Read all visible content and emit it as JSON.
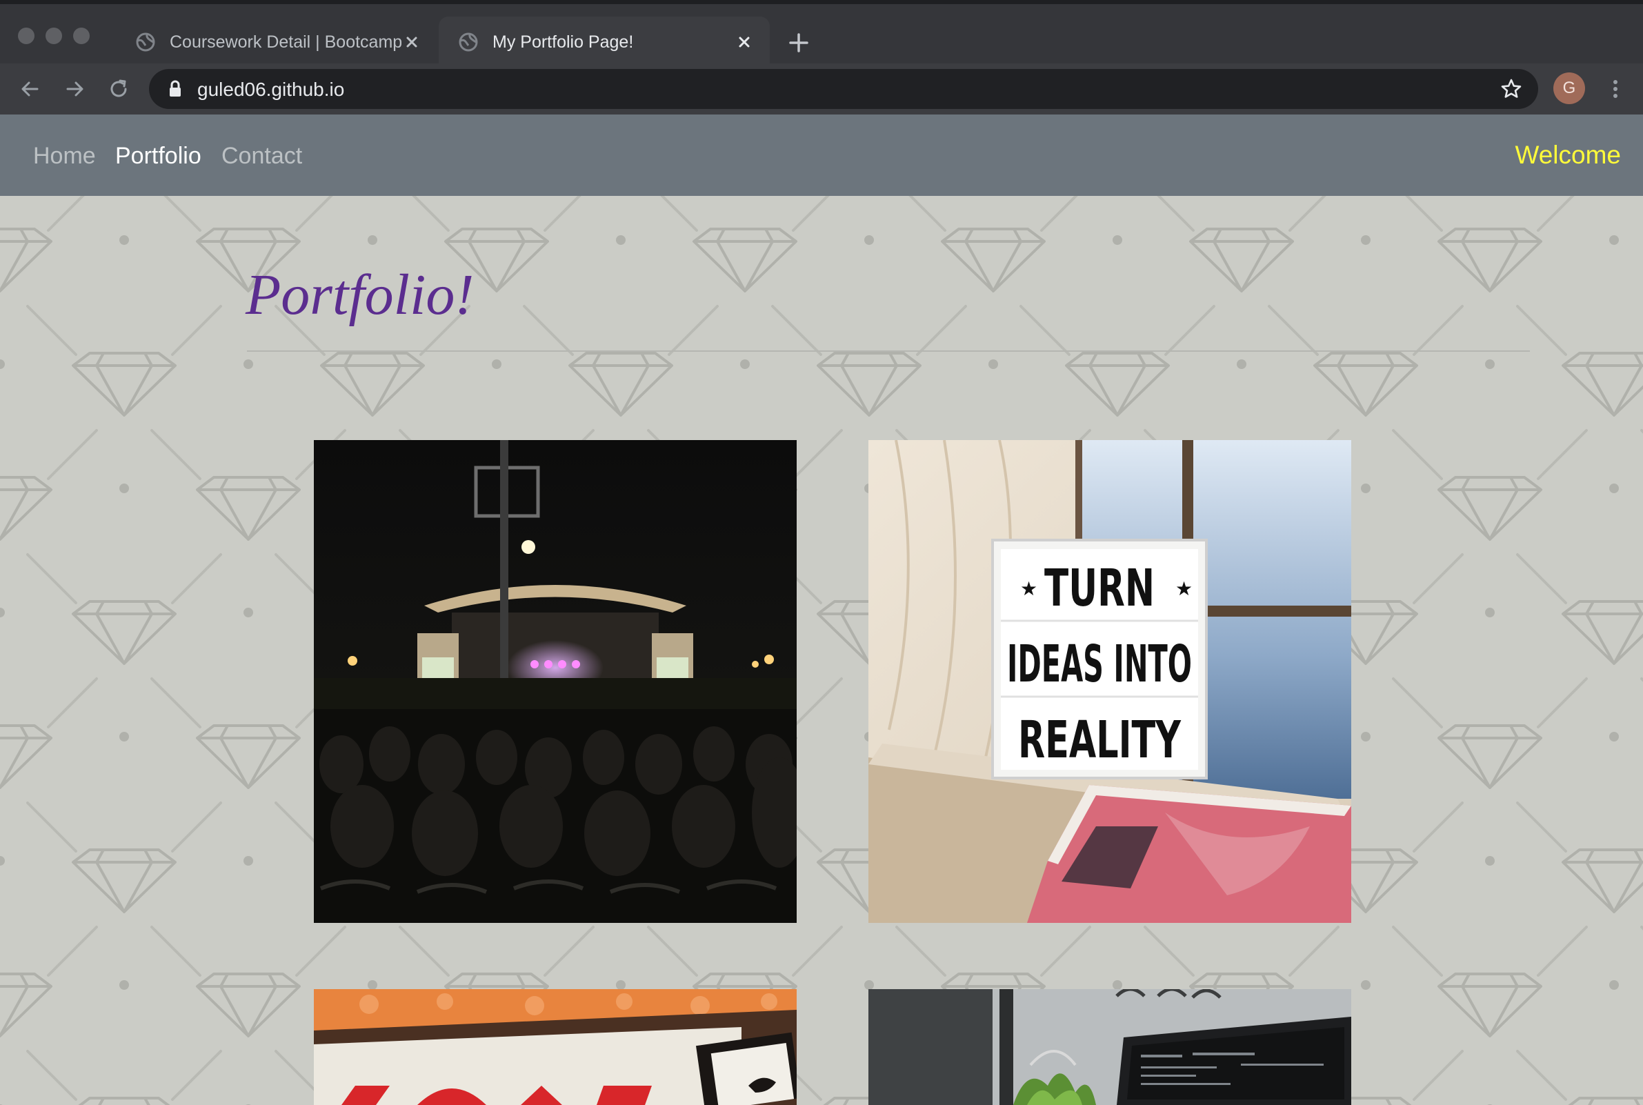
{
  "browser": {
    "tabs": [
      {
        "title": "Coursework Detail | Bootcamp",
        "active": false
      },
      {
        "title": "My Portfolio Page!",
        "active": true
      }
    ],
    "url": "guled06.github.io",
    "profile_initial": "G"
  },
  "navbar": {
    "links": [
      "Home",
      "Portfolio",
      "Contact"
    ],
    "active_link": "Portfolio",
    "right_text": "Welcome"
  },
  "page": {
    "heading": "Portfolio!",
    "sign_text": [
      "TURN",
      "IDEAS INTO",
      "REALITY"
    ]
  },
  "colors": {
    "navbar_bg": "#6c757d",
    "welcome": "#fffb3a",
    "heading": "#5b2d8f",
    "page_bg": "#cbccc6"
  }
}
